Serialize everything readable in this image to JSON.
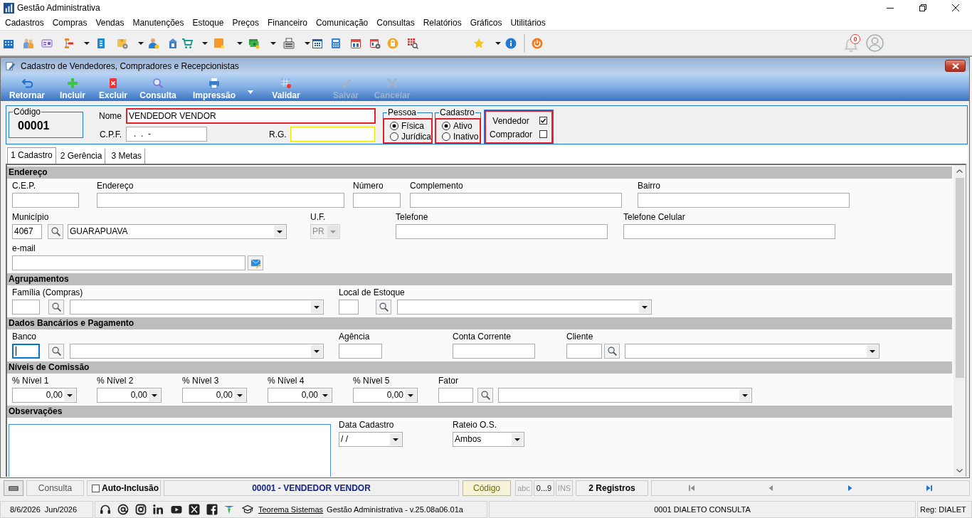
{
  "window": {
    "title": "Gestão Administrativa"
  },
  "menu": [
    "Cadastros",
    "Compras",
    "Vendas",
    "Manutenções",
    "Estoque",
    "Preços",
    "Financeiro",
    "Comunicação",
    "Consultas",
    "Relatórios",
    "Gráficos",
    "Utilitários"
  ],
  "notifications": {
    "count": "0"
  },
  "form_window": {
    "title": "Cadastro de Vendedores, Compradores e Recepcionistas"
  },
  "actions": [
    {
      "label": "Retornar",
      "disabled": false,
      "dropdown": false
    },
    {
      "label": "Incluir",
      "disabled": false,
      "dropdown": false
    },
    {
      "label": "Excluir",
      "disabled": false,
      "dropdown": false
    },
    {
      "label": "Consulta",
      "disabled": false,
      "dropdown": false
    },
    {
      "label": "Impressão",
      "disabled": false,
      "dropdown": true
    },
    {
      "label": "Validar",
      "disabled": false,
      "dropdown": false
    },
    {
      "label": "Salvar",
      "disabled": true,
      "dropdown": false
    },
    {
      "label": "Cancelar",
      "disabled": true,
      "dropdown": false
    }
  ],
  "header": {
    "code": {
      "label": "Código",
      "value": "00001"
    },
    "name": {
      "label": "Nome",
      "value": "VENDEDOR VENDOR"
    },
    "cpf": {
      "label": "C.P.F.",
      "value": ".  .  -"
    },
    "rg": {
      "label": "R.G."
    },
    "person_type": {
      "label": "Pessoa",
      "options": [
        {
          "label": "Física",
          "selected": true
        },
        {
          "label": "Jurídica",
          "selected": false
        }
      ]
    },
    "status": {
      "label": "Cadastro",
      "options": [
        {
          "label": "Ativo",
          "selected": true
        },
        {
          "label": "Inativo",
          "selected": false
        }
      ]
    },
    "roles": [
      {
        "label": "Vendedor",
        "checked": true
      },
      {
        "label": "Comprador",
        "checked": false
      }
    ]
  },
  "tabs": [
    {
      "label": "1 Cadastro",
      "selected": true
    },
    {
      "label": "2 Gerência",
      "selected": false
    },
    {
      "label": "3 Metas",
      "selected": false
    }
  ],
  "sections": [
    {
      "title": "Endereço",
      "rows": [
        {
          "fields": [
            {
              "kind": "text",
              "label": "C.E.P.",
              "focused": false,
              "disabled": false
            },
            {
              "kind": "text",
              "label": "Endereço",
              "focused": false,
              "disabled": false
            },
            {
              "kind": "text",
              "label": "Número",
              "focused": false,
              "disabled": false
            },
            {
              "kind": "text",
              "label": "Complemento",
              "focused": false,
              "disabled": false
            },
            {
              "kind": "text",
              "label": "Bairro",
              "focused": false,
              "disabled": false
            }
          ]
        },
        {
          "fields": [
            {
              "kind": "lookup",
              "label": "Município",
              "code": "4067",
              "value": "GUARAPUAVA",
              "focused": false,
              "disabled": false
            },
            {
              "kind": "combo",
              "label": "U.F.",
              "value": "PR",
              "focused": false,
              "disabled": true
            },
            {
              "kind": "text",
              "label": "Telefone",
              "focused": false,
              "disabled": false
            },
            {
              "kind": "text",
              "label": "Telefone Celular",
              "focused": false,
              "disabled": false
            }
          ]
        },
        {
          "fields": [
            {
              "kind": "email",
              "label": "e-mail",
              "focused": false,
              "disabled": false
            }
          ]
        }
      ]
    },
    {
      "title": "Agrupamentos",
      "rows": [
        {
          "fields": [
            {
              "kind": "lookup",
              "label": "Família (Compras)",
              "focused": false,
              "disabled": false
            },
            {
              "kind": "lookup",
              "label": "Local de Estoque",
              "focused": false,
              "disabled": false
            }
          ]
        }
      ]
    },
    {
      "title": "Dados Bancários e Pagamento",
      "rows": [
        {
          "fields": [
            {
              "kind": "lookup",
              "label": "Banco",
              "focused": true,
              "disabled": false
            },
            {
              "kind": "text",
              "label": "Agência",
              "focused": false,
              "disabled": false
            },
            {
              "kind": "text",
              "label": "Conta Corrente",
              "focused": false,
              "disabled": false
            },
            {
              "kind": "lookup",
              "label": "Cliente",
              "focused": false,
              "disabled": false
            }
          ]
        }
      ]
    },
    {
      "title": "Níveis de Comissão",
      "rows": [
        {
          "fields": [
            {
              "kind": "amount",
              "label": "% Nível 1",
              "value": "0,00",
              "focused": false,
              "disabled": false
            },
            {
              "kind": "amount",
              "label": "% Nível 2",
              "value": "0,00",
              "focused": false,
              "disabled": false
            },
            {
              "kind": "amount",
              "label": "% Nível 3",
              "value": "0,00",
              "focused": false,
              "disabled": false
            },
            {
              "kind": "amount",
              "label": "% Nível 4",
              "value": "0,00",
              "focused": false,
              "disabled": false
            },
            {
              "kind": "amount",
              "label": "% Nível 5",
              "value": "0,00",
              "focused": false,
              "disabled": false
            },
            {
              "kind": "lookup",
              "label": "Fator",
              "focused": false,
              "disabled": false
            }
          ]
        }
      ]
    },
    {
      "title": "Observações",
      "rows": [
        {
          "fields": [
            {
              "kind": "memo",
              "focused": false,
              "disabled": false
            },
            {
              "kind": "combo",
              "label": "Data Cadastro",
              "value": "/ /",
              "focused": false,
              "disabled": false
            },
            {
              "kind": "combo",
              "label": "Rateio O.S.",
              "value": "Ambos",
              "focused": false,
              "disabled": false
            }
          ]
        }
      ]
    }
  ],
  "navigator": {
    "mode": "Consulta",
    "auto_insert": {
      "label": "Auto-Inclusão",
      "checked": false
    },
    "record": "00001 - VENDEDOR VENDOR",
    "order": "Código",
    "indicators": [
      {
        "label": "abc",
        "on": false
      },
      {
        "label": "0...9",
        "on": true
      },
      {
        "label": "INS",
        "on": false
      }
    ],
    "count": "2 Registros",
    "buttons": [
      {
        "disabled": true
      },
      {
        "disabled": true
      },
      {
        "disabled": false
      },
      {
        "disabled": false
      }
    ]
  },
  "status_bar": {
    "date": "8/6/2026",
    "period": "Jun/2026",
    "company_link": "Teorema Sistemas",
    "version": "Gestão Administrativa - v.25.08a06.01a",
    "user": "0001 DIALETO CONSULTA",
    "register": "Reg: DIALET"
  }
}
